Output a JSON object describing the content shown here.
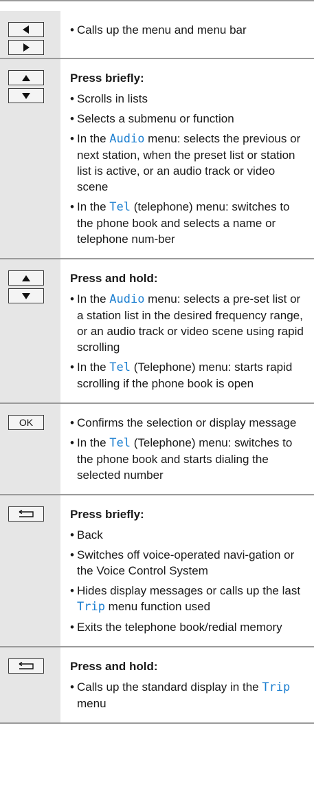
{
  "rows": [
    {
      "keys": [
        "left-arrow",
        "right-arrow"
      ],
      "heading": "",
      "bullets": [
        [
          "Calls up the menu and menu bar"
        ]
      ]
    },
    {
      "keys": [
        "up-arrow",
        "down-arrow"
      ],
      "heading": "Press briefly:",
      "bullets": [
        [
          "Scrolls in lists"
        ],
        [
          "Selects a submenu or function"
        ],
        [
          "In the ",
          {
            "hl": "Audio"
          },
          " menu: selects the previous or next station, when the preset list or station list is active, or an audio track or video scene"
        ],
        [
          "In the ",
          {
            "hl": "Tel"
          },
          " (telephone) menu: switches to the phone book and selects a name or telephone num-ber"
        ]
      ]
    },
    {
      "keys": [
        "up-arrow",
        "down-arrow"
      ],
      "heading": "Press and hold:",
      "bullets": [
        [
          "In the ",
          {
            "hl": "Audio"
          },
          " menu: selects a pre-set list or a station list in the desired frequency range, or an audio track or video scene using rapid scrolling"
        ],
        [
          "In the ",
          {
            "hl": "Tel"
          },
          " (Telephone) menu: starts rapid scrolling if the phone book is open"
        ]
      ]
    },
    {
      "keys": [
        "ok"
      ],
      "ok_label": "OK",
      "heading": "",
      "bullets": [
        [
          "Confirms the selection or display message"
        ],
        [
          "In the ",
          {
            "hl": "Tel"
          },
          " (Telephone) menu: switches to the phone book and starts dialing the selected number"
        ]
      ]
    },
    {
      "keys": [
        "back"
      ],
      "heading": "Press briefly:",
      "bullets": [
        [
          "Back"
        ],
        [
          "Switches off voice-operated navi-gation or the Voice Control System"
        ],
        [
          "Hides display messages or calls up the last ",
          {
            "hl": "Trip"
          },
          " menu function used"
        ],
        [
          "Exits the telephone book/redial memory"
        ]
      ]
    },
    {
      "keys": [
        "back"
      ],
      "heading": "Press and hold:",
      "bullets": [
        [
          "Calls up the standard display in the ",
          {
            "hl": "Trip"
          },
          " menu"
        ]
      ]
    }
  ],
  "colors": {
    "key_column_bg": "#e6e6e6",
    "highlight": "#1c7fd0",
    "divider": "#9a9a9a"
  }
}
